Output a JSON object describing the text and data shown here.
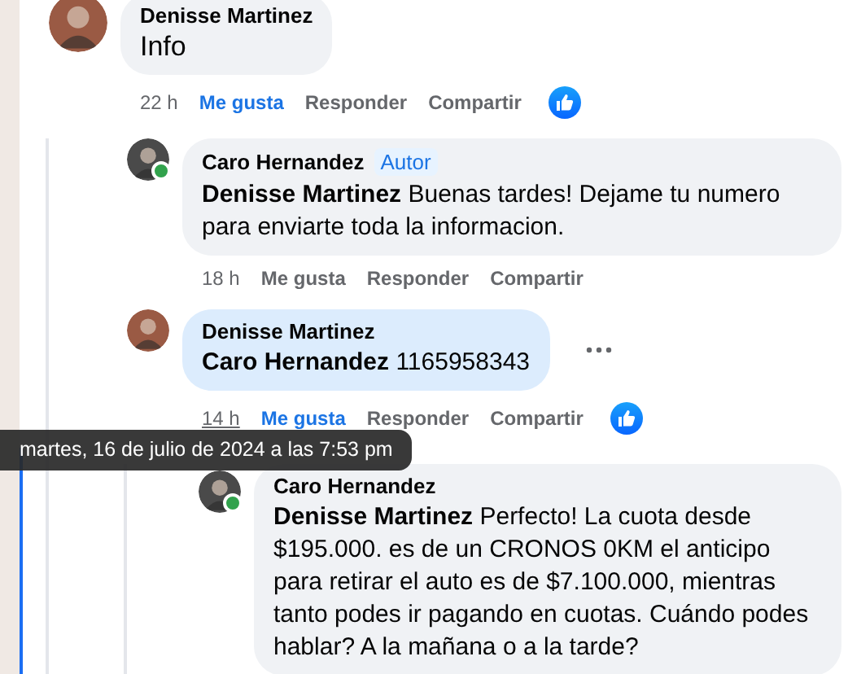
{
  "comments": [
    {
      "avatar": {
        "color": "#9a5a44"
      },
      "author": "Denisse Martinez",
      "text": "Info",
      "time": "22 h",
      "time_hovered": false,
      "actions": [
        {
          "label": "Me gusta",
          "selected": true
        },
        {
          "label": "Responder",
          "selected": false
        },
        {
          "label": "Compartir",
          "selected": false
        }
      ],
      "reaction": true,
      "children": [
        {
          "avatar": {
            "color": "#4a4a4a",
            "online": true
          },
          "author": "Caro Hernandez",
          "badge": "Autor",
          "mention": "Denisse Martinez",
          "text": "Buenas tardes! Dejame tu numero para enviarte toda la informacion.",
          "time": "18 h",
          "time_hovered": false,
          "actions": [
            {
              "label": "Me gusta",
              "selected": false
            },
            {
              "label": "Responder",
              "selected": false
            },
            {
              "label": "Compartir",
              "selected": false
            }
          ],
          "highlighted": false
        },
        {
          "avatar": {
            "color": "#9a5a44"
          },
          "author": "Denisse Martinez",
          "mention": "Caro Hernandez",
          "text": "1165958343",
          "time": "14 h",
          "time_hovered": true,
          "actions": [
            {
              "label": "Me gusta",
              "selected": true
            },
            {
              "label": "Responder",
              "selected": false
            },
            {
              "label": "Compartir",
              "selected": false
            }
          ],
          "reaction": true,
          "more_menu": true,
          "highlighted": true,
          "children": [
            {
              "avatar": {
                "color": "#4a4a4a",
                "online": true
              },
              "author": "Caro Hernandez",
              "mention": "Denisse Martinez",
              "text": "Perfecto! La cuota desde $195.000. es de un CRONOS 0KM el anticipo para retirar el auto es de $7.100.000, mientras tanto podes ir pagando en cuotas. Cuándo podes hablar? A la mañana o a la tarde?",
              "highlighted": false
            }
          ]
        }
      ]
    }
  ],
  "tooltip": "martes, 16 de julio de 2024 a las 7:53 pm"
}
